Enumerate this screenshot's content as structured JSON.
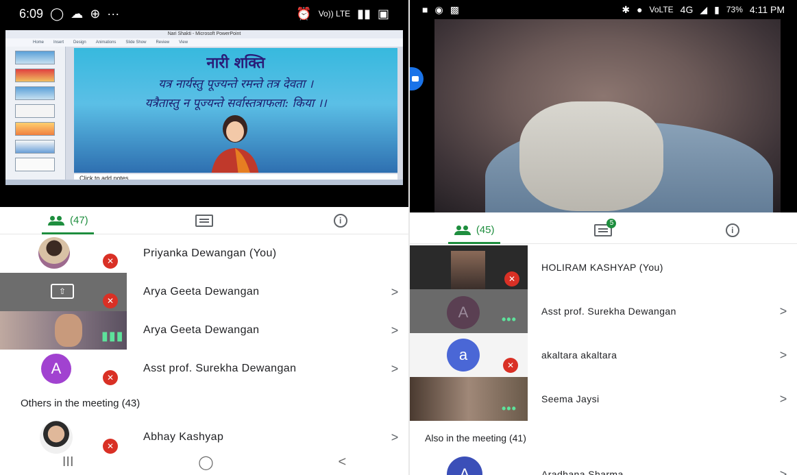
{
  "left": {
    "status": {
      "time": "6:09",
      "icons_left": [
        "whatsapp-icon",
        "cloud-icon",
        "grid-icon",
        "more-icon"
      ],
      "more": "···",
      "carrier": "Vo)) LTE",
      "icons_right": [
        "alarm-icon",
        "signal-icon",
        "battery-icon"
      ]
    },
    "slide": {
      "window_title": "Nari Shakti - Microsoft PowerPoint",
      "ribbon": [
        "Home",
        "Insert",
        "Design",
        "Animations",
        "Slide Show",
        "Review",
        "View"
      ],
      "title": "नारी शक्ति",
      "line1": "यत्र नार्यस्तु पूज्यन्ते रमन्ते तत्र देवता ।",
      "line2": "यत्रैतास्तु न पूज्यन्ते सर्वास्तत्राफला: किया ।।",
      "notes": "Click to add notes"
    },
    "tabs": {
      "people_count": "(47)"
    },
    "participants": [
      {
        "name": "Priyanka Dewangan (You)",
        "chevron": ""
      },
      {
        "name": "Arya Geeta Dewangan",
        "chevron": ">"
      },
      {
        "name": "Arya Geeta Dewangan",
        "chevron": ">"
      },
      {
        "name": "Asst prof. Surekha Dewangan",
        "chevron": ">",
        "initial": "A"
      }
    ],
    "others_header": "Others in the meeting (43)",
    "others": [
      {
        "name": "Abhay Kashyap",
        "chevron": ">"
      }
    ],
    "navbar": [
      "III",
      "◯",
      "<"
    ]
  },
  "right": {
    "status": {
      "network": "4G",
      "volte": "VoLTE",
      "battery": "73%",
      "time": "4:11 PM"
    },
    "tabs": {
      "people_count": "(45)",
      "chat_badge": "5"
    },
    "participants": [
      {
        "name": "HOLIRAM KASHYAP (You)",
        "chevron": ""
      },
      {
        "name": "Asst prof. Surekha Dewangan",
        "chevron": ">",
        "initial": "A"
      },
      {
        "name": "akaltara akaltara",
        "chevron": ">",
        "initial": "a"
      },
      {
        "name": "Seema Jaysi",
        "chevron": ">"
      }
    ],
    "also_header": "Also in the meeting (41)",
    "also": [
      {
        "name": "Aradhana Sharma",
        "chevron": ">",
        "initial": "A"
      }
    ]
  },
  "colors": {
    "accent_green": "#1e8e3e",
    "mute_red": "#d93025",
    "avatar_purple": "#a142d0",
    "avatar_blue": "#4a67d6"
  }
}
